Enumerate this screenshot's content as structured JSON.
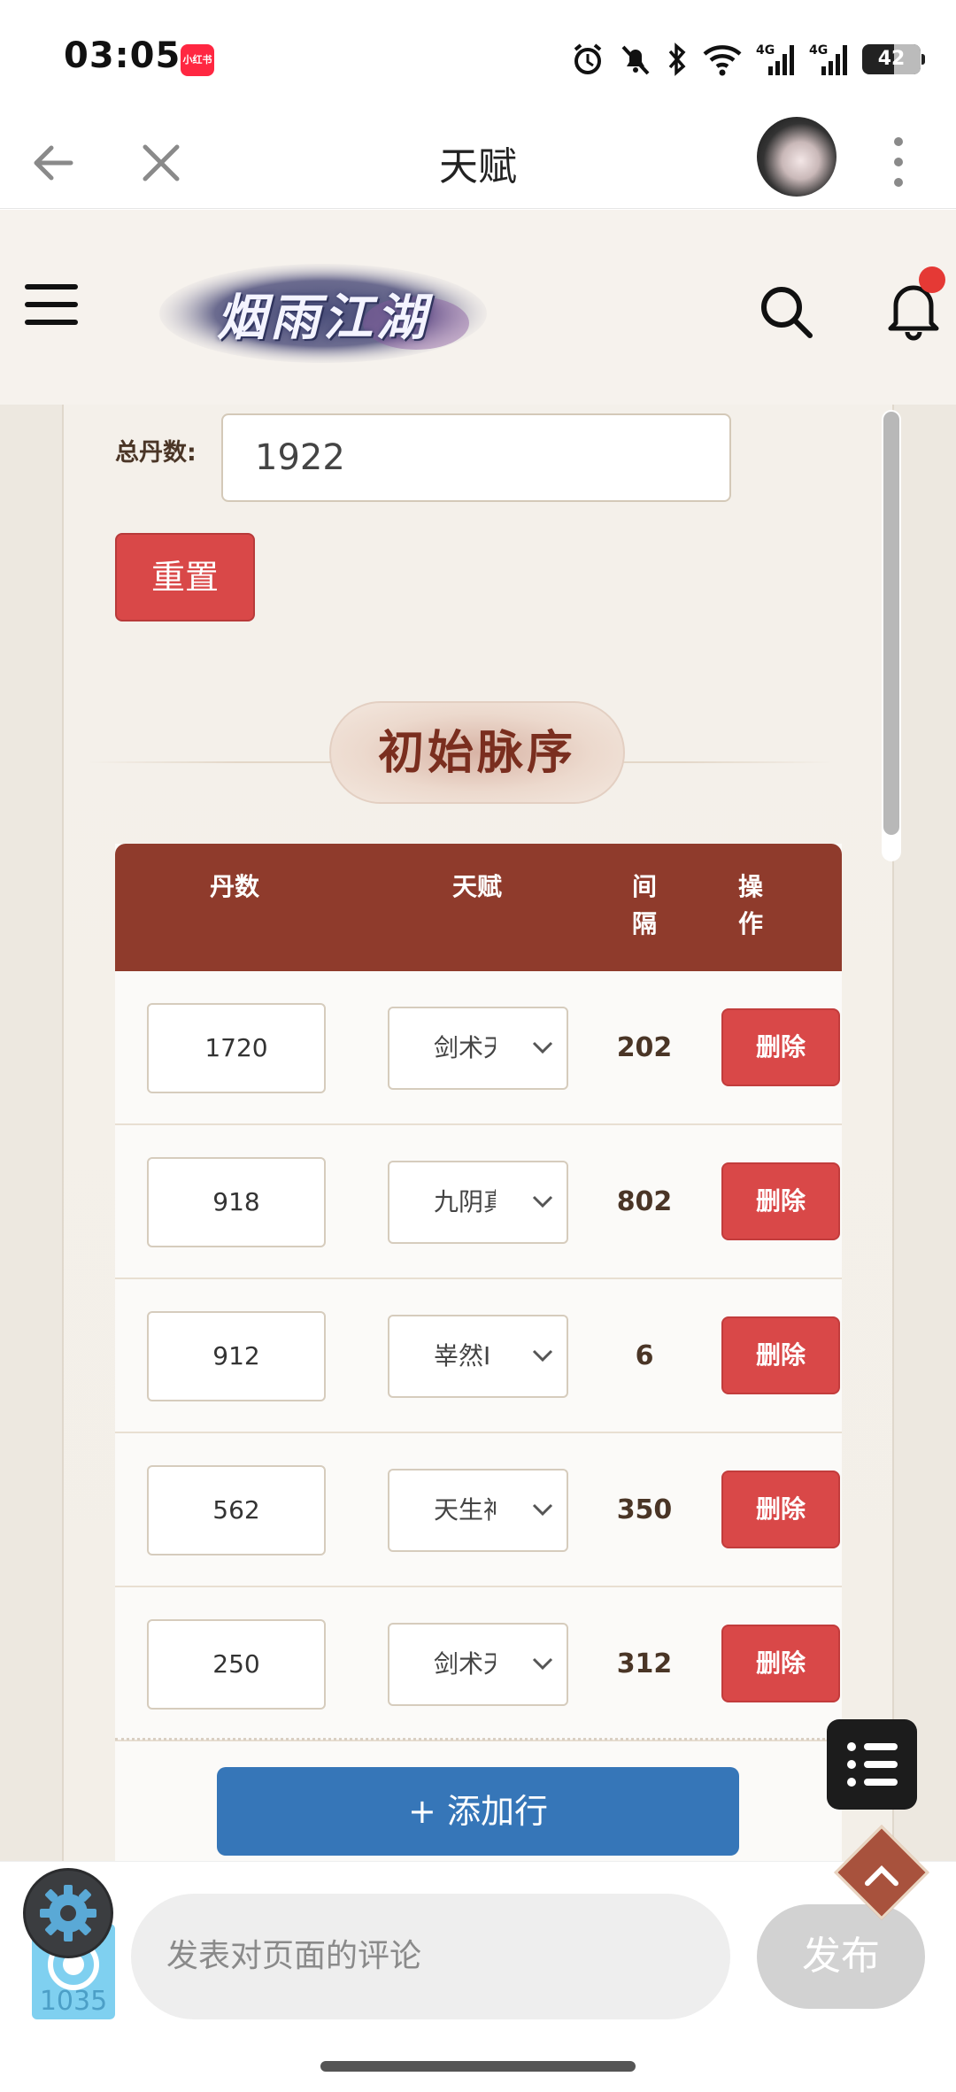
{
  "status_bar": {
    "time": "03:05",
    "app_badge": "小红书",
    "battery": "42",
    "icons": [
      "alarm-icon",
      "mute-icon",
      "bluetooth-icon",
      "wifi-icon",
      "signal-4g-icon",
      "signal-4g-icon",
      "battery-icon"
    ]
  },
  "nav": {
    "title": "天赋",
    "back_icon": "arrow-left-icon",
    "close_icon": "close-icon",
    "more_icon": "more-vertical-icon"
  },
  "site": {
    "logo_text": "烟雨江湖"
  },
  "form": {
    "total_label": "总丹数:",
    "total_value": "1922",
    "reset_label": "重置"
  },
  "section": {
    "title": "初始脉序"
  },
  "table": {
    "headers": {
      "dan": "丹数",
      "talent": "天赋",
      "gap": "间\n隔",
      "op": "操\n作"
    },
    "rows": [
      {
        "dan": "1720",
        "talent": "剑术天",
        "gap": "202",
        "action": "删除"
      },
      {
        "dan": "918",
        "talent": "九阴真",
        "gap": "802",
        "action": "删除"
      },
      {
        "dan": "912",
        "talent": "峷然I",
        "gap": "6",
        "action": "删除"
      },
      {
        "dan": "562",
        "talent": "天生神",
        "gap": "350",
        "action": "删除"
      },
      {
        "dan": "250",
        "talent": "剑术天",
        "gap": "312",
        "action": "删除"
      }
    ],
    "add_row_label": "+ 添加行"
  },
  "comment": {
    "placeholder": "发表对页面的评论",
    "publish_label": "发布",
    "app_count": "1035"
  },
  "colors": {
    "header_brown": "#8f3b2c",
    "delete_red": "#d94848",
    "add_blue": "#3676b8"
  }
}
